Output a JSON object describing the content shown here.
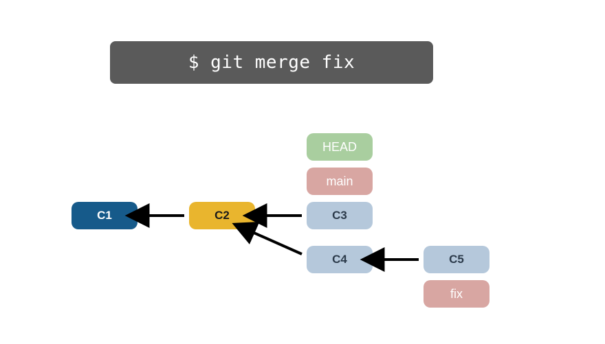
{
  "command": "$ git merge fix",
  "refs": {
    "head": {
      "label": "HEAD",
      "color": "#a9ce9f"
    },
    "main": {
      "label": "main",
      "color": "#d8a6a2"
    },
    "fix": {
      "label": "fix",
      "color": "#d8a6a2"
    }
  },
  "commits": {
    "c1": {
      "label": "C1",
      "color": "#165a8a"
    },
    "c2": {
      "label": "C2",
      "color": "#e9b52e"
    },
    "c3": {
      "label": "C3",
      "color": "#b5c8db"
    },
    "c4": {
      "label": "C4",
      "color": "#b5c8db"
    },
    "c5": {
      "label": "C5",
      "color": "#b5c8db"
    }
  },
  "edges": [
    {
      "from": "c2",
      "to": "c1"
    },
    {
      "from": "c3",
      "to": "c2"
    },
    {
      "from": "c4",
      "to": "c2"
    },
    {
      "from": "c5",
      "to": "c4"
    }
  ],
  "chart_data": {
    "type": "diagram",
    "title": "$ git merge fix",
    "nodes": [
      {
        "id": "C1",
        "kind": "commit"
      },
      {
        "id": "C2",
        "kind": "commit"
      },
      {
        "id": "C3",
        "kind": "commit"
      },
      {
        "id": "C4",
        "kind": "commit"
      },
      {
        "id": "C5",
        "kind": "commit"
      },
      {
        "id": "HEAD",
        "kind": "ref",
        "points_to": "C3"
      },
      {
        "id": "main",
        "kind": "ref",
        "points_to": "C3"
      },
      {
        "id": "fix",
        "kind": "ref",
        "points_to": "C5"
      }
    ],
    "edges": [
      {
        "from": "C2",
        "to": "C1",
        "relation": "parent"
      },
      {
        "from": "C3",
        "to": "C2",
        "relation": "parent"
      },
      {
        "from": "C4",
        "to": "C2",
        "relation": "parent"
      },
      {
        "from": "C5",
        "to": "C4",
        "relation": "parent"
      }
    ]
  }
}
